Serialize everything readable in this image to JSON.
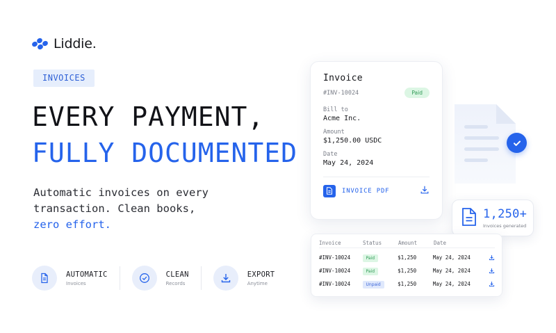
{
  "brand": {
    "name": "Liddie."
  },
  "hero": {
    "tag": "INVOICES",
    "headline_line1": "EVERY PAYMENT,",
    "headline_line2": "FULLY DOCUMENTED",
    "desc_line1": "Automatic invoices on every",
    "desc_line2": "transaction. Clean books,",
    "desc_highlight": "zero effort."
  },
  "features": [
    {
      "title": "AUTOMATIC",
      "subtitle": "Invoices",
      "icon": "document-icon"
    },
    {
      "title": "CLEAN",
      "subtitle": "Records",
      "icon": "check-circle-icon"
    },
    {
      "title": "EXPORT",
      "subtitle": "Anytime",
      "icon": "download-icon"
    }
  ],
  "invoice": {
    "title": "Invoice",
    "number": "#INV-10024",
    "status": "Paid",
    "bill_to_label": "Bill to",
    "bill_to_value": "Acme Inc.",
    "amount_label": "Amount",
    "amount_value": "$1,250.00 USDC",
    "date_label": "Date",
    "date_value": "May 24, 2024",
    "pdf_label": "INVOICE PDF"
  },
  "stat": {
    "value": "1,250+",
    "label": "Invoices generated"
  },
  "table": {
    "headers": [
      "Invoice",
      "Status",
      "Amount",
      "Date"
    ],
    "rows": [
      {
        "invoice": "#INV-10024",
        "status": "Paid",
        "amount": "$1,250",
        "date": "May 24, 2024"
      },
      {
        "invoice": "#INV-10024",
        "status": "Paid",
        "amount": "$1,250",
        "date": "May 24, 2024"
      },
      {
        "invoice": "#INV-10024",
        "status": "Unpaid",
        "amount": "$1,250",
        "date": "May 24, 2024"
      }
    ]
  },
  "colors": {
    "accent": "#2563eb",
    "paid_bg": "#dcf6e4",
    "paid_text": "#2f9a55",
    "unpaid_bg": "#dfe8fc"
  }
}
